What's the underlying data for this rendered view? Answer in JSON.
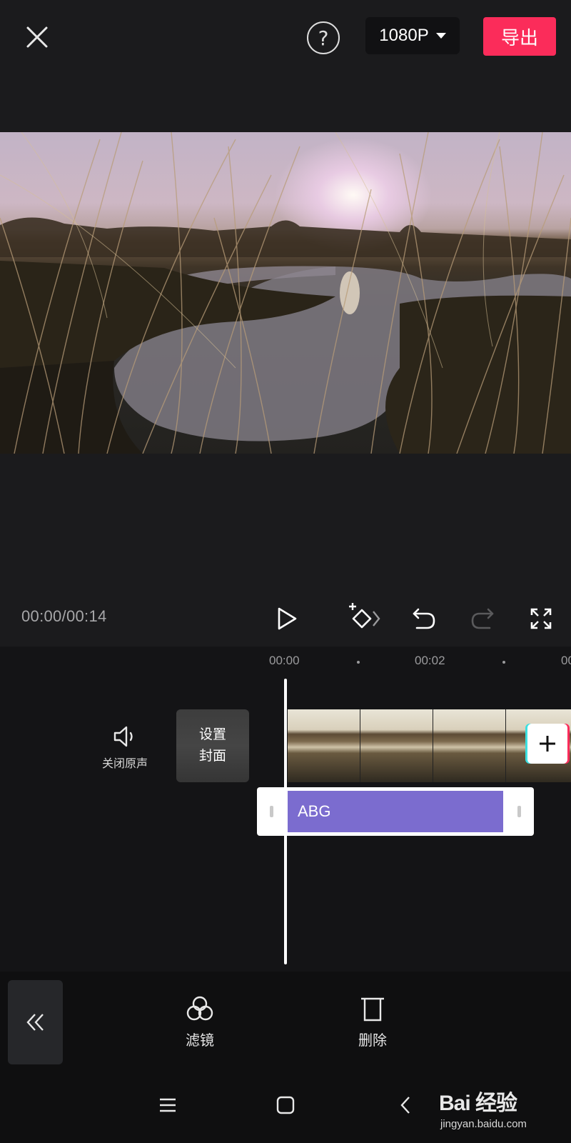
{
  "top_bar": {
    "close_icon": "close-icon",
    "help_icon": "help-icon",
    "help_glyph": "?",
    "resolution": "1080P",
    "export_label": "导出",
    "export_color": "#fb2c5a"
  },
  "preview": {
    "description_icon": "video-preview"
  },
  "playback": {
    "time": "00:00/00:14",
    "icons": [
      "play-icon",
      "keyframe-icon",
      "undo-icon",
      "redo-icon",
      "fullscreen-icon"
    ]
  },
  "timeline": {
    "ruler": [
      "00:00",
      "00:02",
      "00"
    ],
    "mute_label": "关闭原声",
    "cover_line1": "设置",
    "cover_line2": "封面",
    "text_clip_label": "ABG",
    "text_clip_color": "#7b6ccf"
  },
  "toolbar": {
    "collapse_icon": "double-chevron-left-icon",
    "tools": [
      {
        "label": "滤镜",
        "icon": "filter-icon"
      },
      {
        "label": "删除",
        "icon": "delete-icon"
      }
    ]
  },
  "navbar": {
    "icons": [
      "menu-icon",
      "home-icon",
      "back-icon"
    ]
  },
  "watermark": {
    "logo": "Bai 经验",
    "url": "jingyan.baidu.com"
  }
}
